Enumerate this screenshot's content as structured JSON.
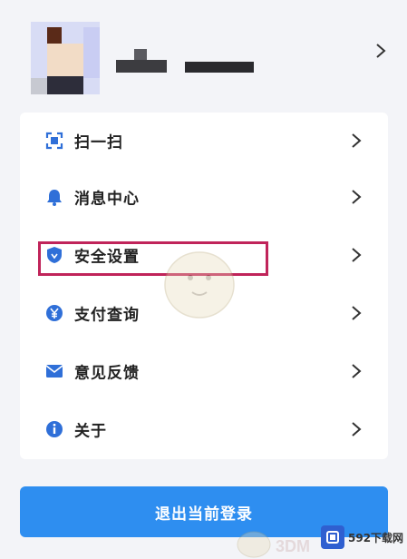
{
  "profile": {
    "avatar": "avatar-image",
    "chevron_icon": "chevron-right-icon"
  },
  "menu": {
    "items": [
      {
        "label": "扫一扫",
        "icon": "scan-icon"
      },
      {
        "label": "消息中心",
        "icon": "bell-icon"
      },
      {
        "label": "安全设置",
        "icon": "shield-icon"
      },
      {
        "label": "支付查询",
        "icon": "yen-icon"
      },
      {
        "label": "意见反馈",
        "icon": "mail-icon"
      },
      {
        "label": "关于",
        "icon": "info-icon"
      }
    ],
    "highlighted_item": "安全设置",
    "highlight_color": "#c0245a"
  },
  "logout": {
    "label": "退出当前登录"
  },
  "watermark": {
    "logo_text": "592下载网",
    "brand": "3DM"
  },
  "colors": {
    "accent": "#2e8ef0",
    "icon": "#2f6fd8",
    "background": "#f3f4f8"
  }
}
